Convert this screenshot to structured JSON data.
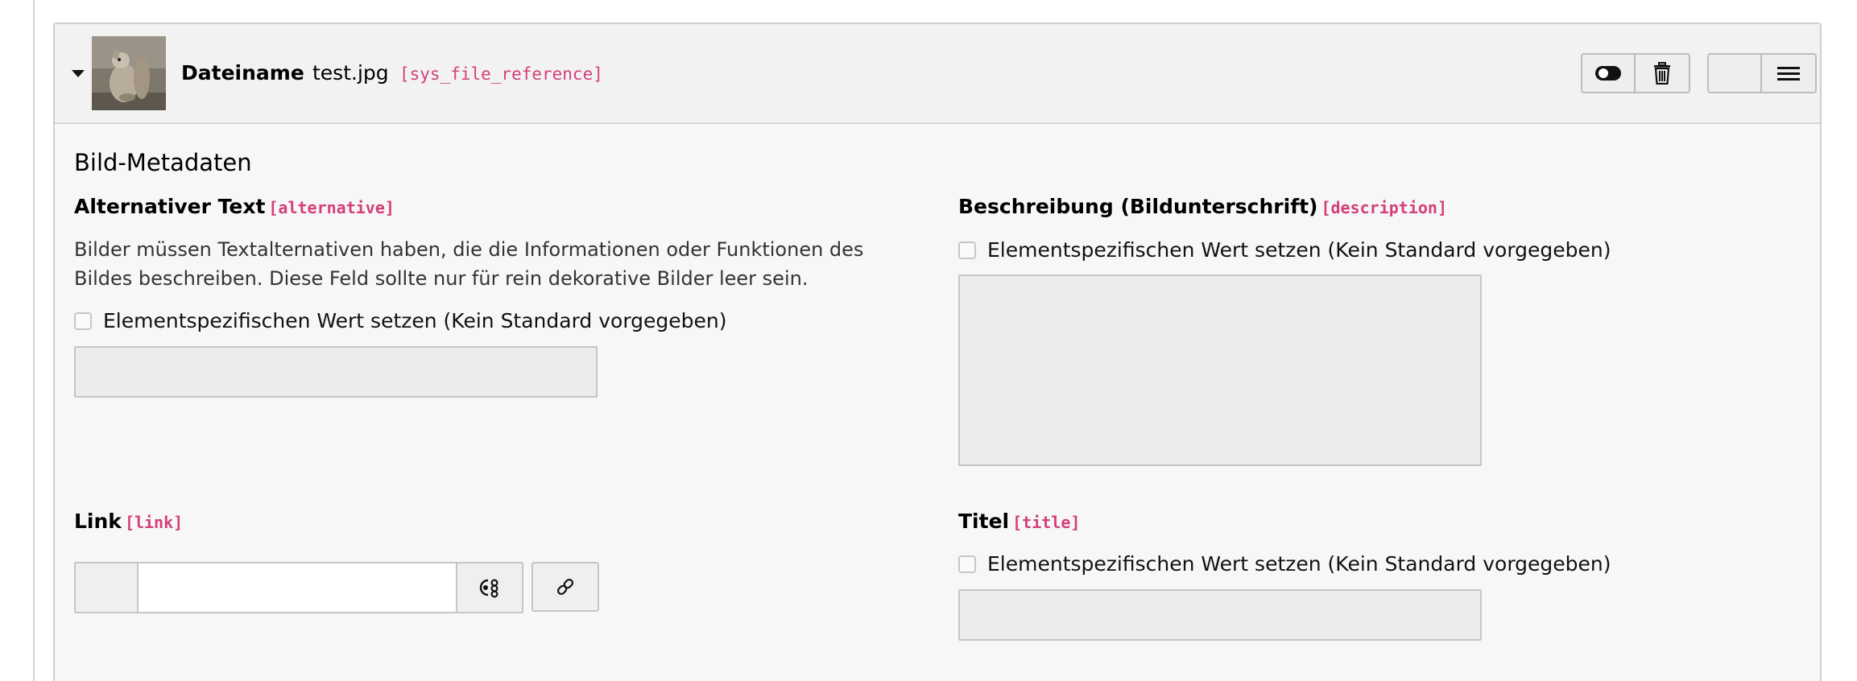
{
  "header": {
    "filename_label": "Dateiname",
    "filename_value": "test.jpg",
    "table_code": "[sys_file_reference]",
    "thumbnail_icon": "squirrel-thumbnail"
  },
  "actions": {
    "toggle_icon": "toggle-icon",
    "delete_icon": "trash-icon",
    "menu_icon": "hamburger-menu-icon"
  },
  "section_title": "Bild-Metadaten",
  "alternative": {
    "label": "Alternativer Text",
    "code": "[alternative]",
    "description_line1": "Bilder müssen Textalternativen haben, die die Informationen oder Funktionen des",
    "description_line2": "Bildes beschreiben. Diese Feld sollte nur für rein dekorative Bilder leer sein.",
    "override_label": "Elementspezifischen Wert setzen (Kein Standard vorgegeben)"
  },
  "description": {
    "label": "Beschreibung (Bildunterschrift)",
    "code": "[description]",
    "override_label": "Elementspezifischen Wert setzen (Kein Standard vorgegeben)"
  },
  "link": {
    "label": "Link",
    "code": "[link]",
    "value": ""
  },
  "title": {
    "label": "Titel",
    "code": "[title]",
    "override_label": "Elementspezifischen Wert setzen (Kein Standard vorgegeben)"
  },
  "colors": {
    "code_accent": "#d43f7a",
    "panel_bg": "#f7f7f7",
    "disabled_input_bg": "#ececec"
  }
}
